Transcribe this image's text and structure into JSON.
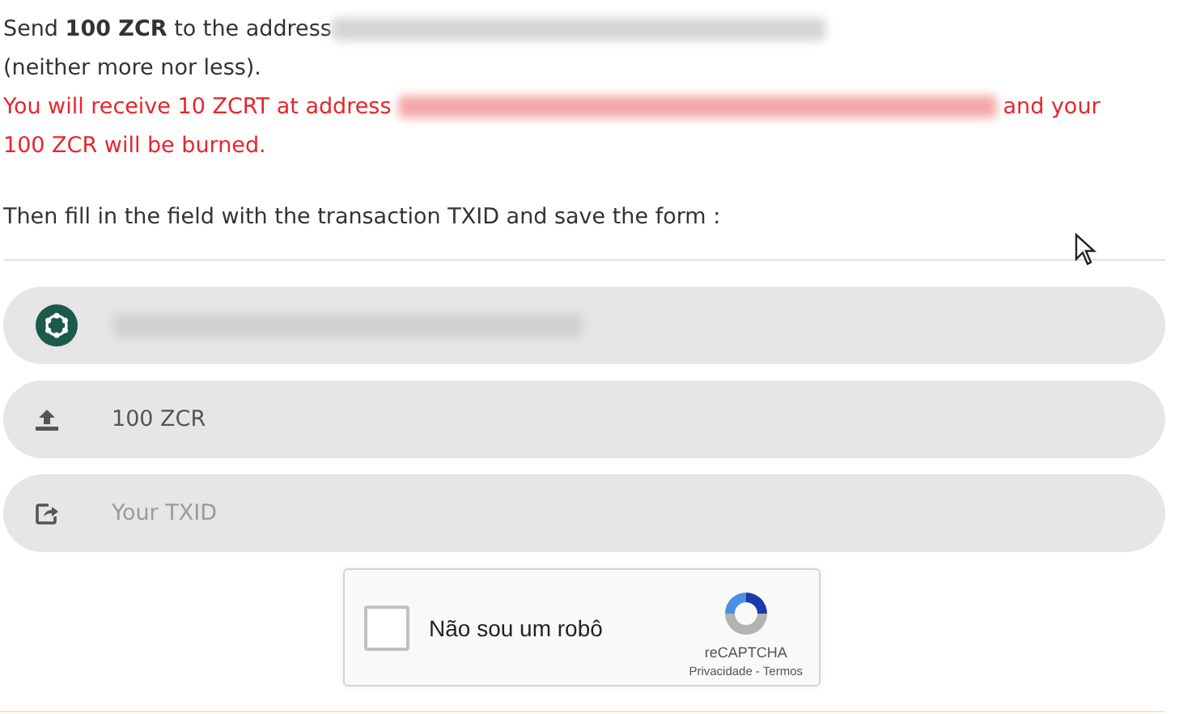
{
  "instructions": {
    "send_prefix": "Send **100 ZCR** to the address",
    "send_suffix": "(neither more nor less).",
    "receive_prefix": "You will receive 10 ZCRT at address",
    "receive_suffix": "and your",
    "receive_line2": "100 ZCR will be burned.",
    "fill_in": "Then fill in the field with the transaction TXID and save the form :"
  },
  "fields": [
    {
      "kind": "address"
    },
    {
      "kind": "amount",
      "value": "100 ZCR"
    },
    {
      "kind": "txid",
      "placeholder": "Your TXID"
    }
  ],
  "captcha": {
    "checked": false,
    "label": "Não sou um robô",
    "brand": "reCAPTCHA",
    "privacy": "Privacidade",
    "separator": "-",
    "terms": "Termos"
  }
}
